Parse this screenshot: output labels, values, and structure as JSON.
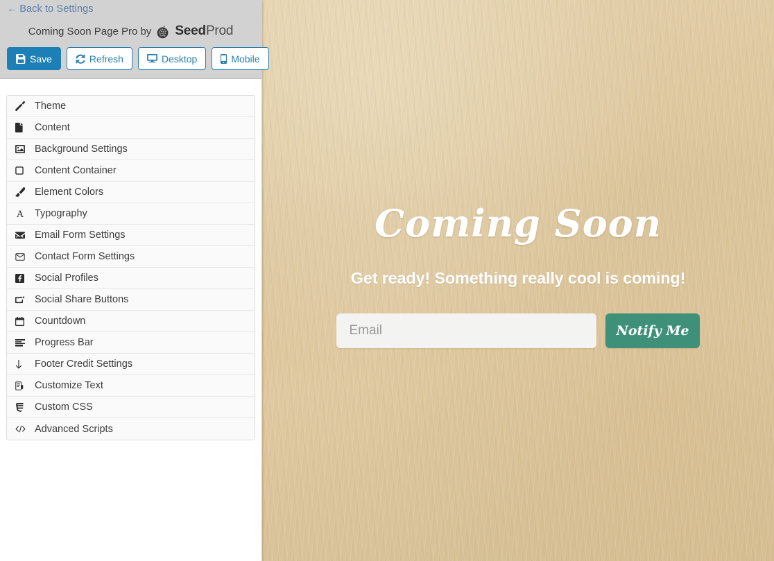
{
  "panel": {
    "back_link": {
      "arrow": "←",
      "label": "Back to Settings"
    },
    "brand": {
      "prefix": "Coming Soon Page Pro by",
      "name_bold": "Seed",
      "name_light": "Prod"
    },
    "buttons": [
      {
        "label": "Save",
        "icon": "floppy-disk-icon",
        "variant": "primary"
      },
      {
        "label": "Refresh",
        "icon": "refresh-icon",
        "variant": "default"
      },
      {
        "label": "Desktop",
        "icon": "desktop-icon",
        "variant": "default"
      },
      {
        "label": "Mobile",
        "icon": "mobile-icon",
        "variant": "default"
      }
    ],
    "menu": [
      {
        "label": "Theme",
        "icon": "magic-wand-icon"
      },
      {
        "label": "Content",
        "icon": "file-icon"
      },
      {
        "label": "Background Settings",
        "icon": "image-icon"
      },
      {
        "label": "Content Container",
        "icon": "square-outline-icon"
      },
      {
        "label": "Element Colors",
        "icon": "paint-brush-icon"
      },
      {
        "label": "Typography",
        "icon": "font-letter-a-icon"
      },
      {
        "label": "Email Form Settings",
        "icon": "envelope-filled-icon"
      },
      {
        "label": "Contact Form Settings",
        "icon": "envelope-outline-icon"
      },
      {
        "label": "Social Profiles",
        "icon": "facebook-icon"
      },
      {
        "label": "Social Share Buttons",
        "icon": "share-arrow-icon"
      },
      {
        "label": "Countdown",
        "icon": "calendar-icon"
      },
      {
        "label": "Progress Bar",
        "icon": "progress-bars-icon"
      },
      {
        "label": "Footer Credit Settings",
        "icon": "arrow-down-icon"
      },
      {
        "label": "Customize Text",
        "icon": "text-document-icon"
      },
      {
        "label": "Custom CSS",
        "icon": "css3-icon"
      },
      {
        "label": "Advanced Scripts",
        "icon": "code-brackets-icon"
      }
    ]
  },
  "preview": {
    "heading": "Coming Soon",
    "subheading": "Get ready! Something really cool is coming!",
    "email_placeholder": "Email",
    "email_value": "",
    "notify_label": "Notify Me"
  },
  "colors": {
    "panel_header_bg": "#d2d2d2",
    "primary_button": "#1c7fb5",
    "link_blue": "#5d80a8",
    "preview_background": "#ddc79f",
    "notify_green": "#3f9078",
    "email_field_bg": "#f3f3f1"
  }
}
